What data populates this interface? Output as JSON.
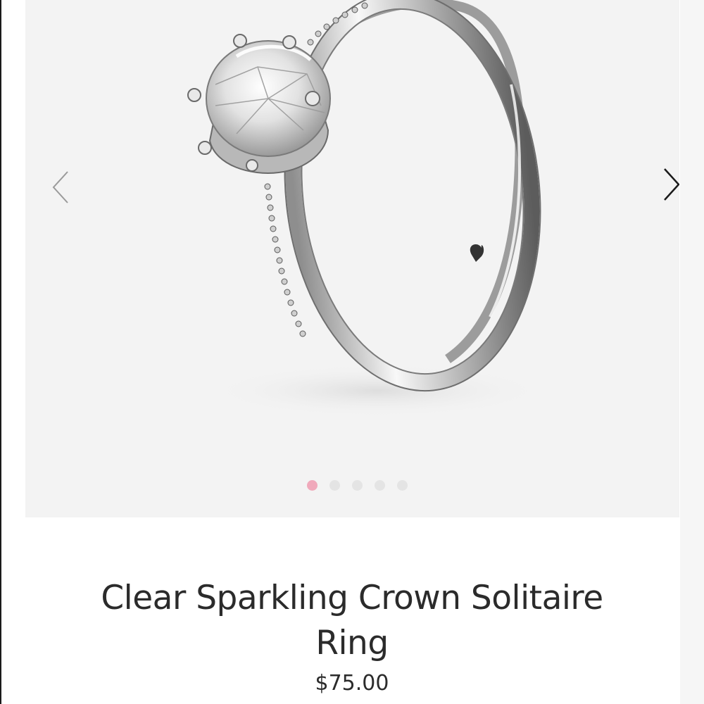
{
  "product": {
    "title": "Clear Sparkling Crown Solitaire Ring",
    "price": "$75.00",
    "image_name": "ring-image"
  },
  "gallery": {
    "prev_icon": "chevron-left-icon",
    "next_icon": "chevron-right-icon",
    "slide_count": 5,
    "active_slide": 1,
    "active_dot_color": "#f0a9bb",
    "inactive_dot_color": "#e4e4e4",
    "background_color": "#f3f3f3"
  }
}
